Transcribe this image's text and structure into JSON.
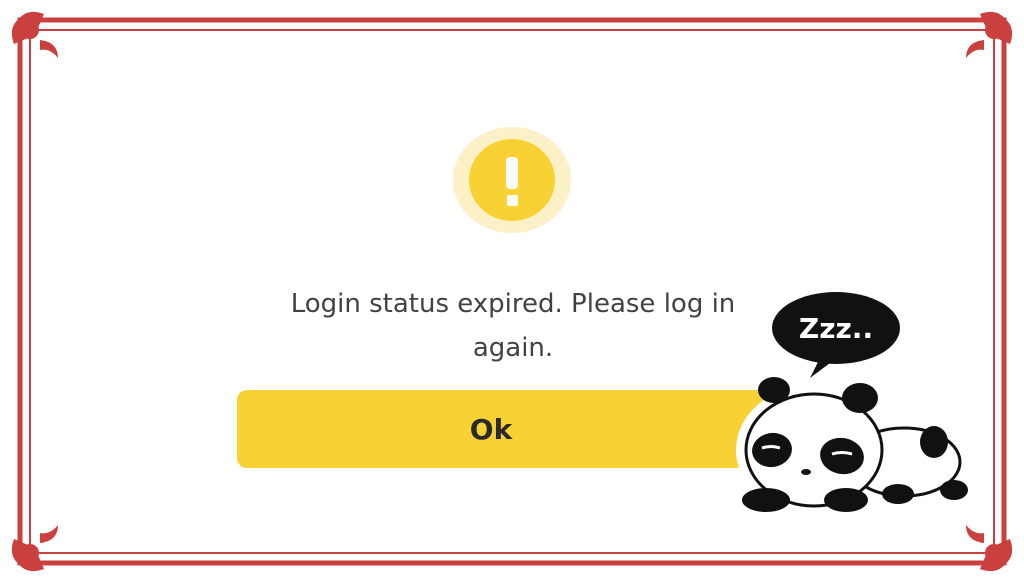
{
  "dialog": {
    "icon": "exclamation-icon",
    "message": "Login status expired. Please log in again.",
    "ok_label": "Ok"
  },
  "sticker": {
    "speech_text": "Zzz..",
    "icon": "sleeping-panda-sticker"
  },
  "colors": {
    "frame": "#c9403f",
    "accent": "#f8d234",
    "accent_light": "#fbf0c6",
    "text": "#424242",
    "background": "#ffffff"
  }
}
